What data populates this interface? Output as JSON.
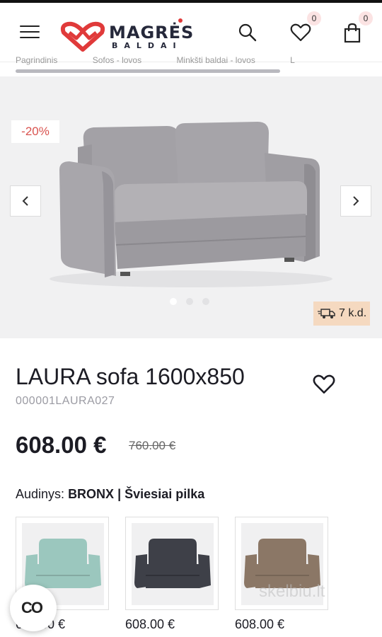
{
  "header": {
    "logo_text": "MAGRĖS",
    "logo_sub": "BALDAI",
    "wishlist_count": "0",
    "cart_count": "0"
  },
  "categories": [
    "Pagrindinis",
    "Sofos - lovos",
    "Minkšti baldai - lovos",
    "L"
  ],
  "gallery": {
    "discount_badge": "-20%",
    "delivery_label": "7 k.d.",
    "slide_count": 3,
    "active_slide": 1
  },
  "product": {
    "title": "LAURA sofa 1600x850",
    "sku": "000001LAURA027",
    "price": "608.00 €",
    "old_price": "760.00 €",
    "fabric_label": "Audinys:",
    "fabric_name": "BRONX",
    "fabric_separator": "|",
    "fabric_color": "Šviesiai pilka"
  },
  "variants": [
    {
      "price": "608.00 €",
      "color": "#9bc7be"
    },
    {
      "price": "608.00 €",
      "color": "#3e4048"
    },
    {
      "price": "608.00 €",
      "color": "#8b7766"
    }
  ],
  "cookie_button": "CO",
  "watermark": "skelbiu.lt",
  "colors": {
    "accent": "#e03a3a",
    "discount": "#d9534f",
    "delivery_bg": "#f5d9c0",
    "sofa_main": "#a9a7ab"
  }
}
